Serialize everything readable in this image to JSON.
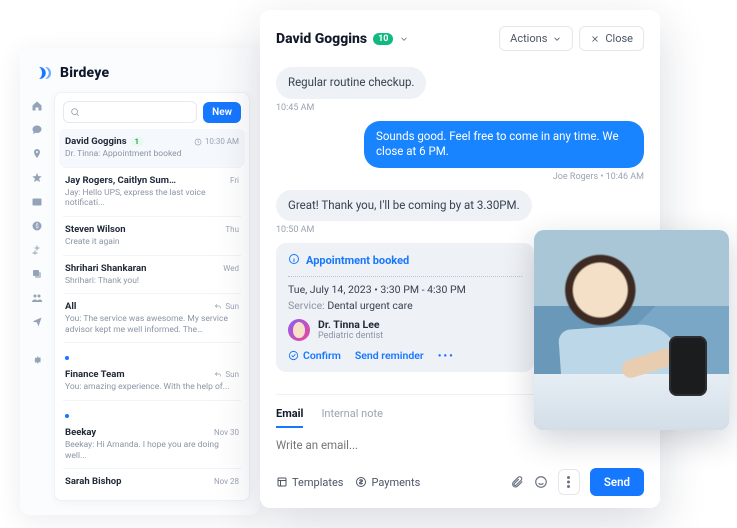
{
  "brand": {
    "name": "Birdeye"
  },
  "colors": {
    "accent": "#1677ff",
    "muted": "#9aa3b2"
  },
  "inbox": {
    "search_placeholder": "",
    "new_label": "New",
    "threads": [
      {
        "name": "David Goggins",
        "badge": "1",
        "meta_icon": "clock",
        "meta": "10:30 AM",
        "preview": "Dr. Tinna: Appointment booked",
        "active": true
      },
      {
        "name": "Jay Rogers, Caitlyn Summer",
        "badge": "",
        "meta_icon": "",
        "meta": "Fri",
        "preview": "Jay: Hello UPS, express the last voice notificati...",
        "active": false
      },
      {
        "name": "Steven Wilson",
        "badge": "",
        "meta_icon": "",
        "meta": "Thu",
        "preview": "Create it again",
        "active": false
      },
      {
        "name": "Shrihari Shankaran",
        "badge": "",
        "meta_icon": "",
        "meta": "Wed",
        "preview": "Shrihari: Thank you!",
        "active": false
      },
      {
        "name": "All",
        "badge": "",
        "meta_icon": "reply",
        "meta": "Sun",
        "preview": "You: The service was awesome. My service advisor kept me well informed. The Experience...",
        "active": false
      },
      {
        "name": "Finance Team",
        "badge": "",
        "meta_icon": "reply",
        "meta": "Sun",
        "preview": "You: amazing experience. With the help of...",
        "active": false,
        "dot": true
      },
      {
        "name": "Beekay",
        "badge": "",
        "meta_icon": "",
        "meta": "Nov 30",
        "preview": "Beekay: Hi Amanda. I hope you are doing well...",
        "active": false,
        "dot": true
      },
      {
        "name": "Sarah Bishop",
        "badge": "",
        "meta_icon": "",
        "meta": "Nov 28",
        "preview": "",
        "active": false
      }
    ]
  },
  "chat": {
    "contact": "David Goggins",
    "badge": "10",
    "actions_label": "Actions",
    "close_label": "Close",
    "msg1": "Regular routine checkup.",
    "t1": "10:45 AM",
    "msg2": "Sounds good. Feel free to come in any time. We close at 6 PM.",
    "t2_meta": "Joe Rogers • 10:46 AM",
    "msg3": "Great! Thank you, I'll be coming by at 3.30PM.",
    "t3": "10:50 AM",
    "appointment": {
      "title": "Appointment booked",
      "when": "Tue, July 14, 2023 • 3:30 PM - 4:30 PM",
      "service_label": "Service:",
      "service_value": "Dental urgent care",
      "doctor_name": "Dr. Tinna Lee",
      "doctor_role": "Pediatric dentist",
      "confirm": "Confirm",
      "reminder": "Send reminder"
    }
  },
  "compose": {
    "tab_email": "Email",
    "tab_note": "Internal note",
    "placeholder": "Write an email...",
    "templates": "Templates",
    "payments": "Payments",
    "send": "Send"
  }
}
